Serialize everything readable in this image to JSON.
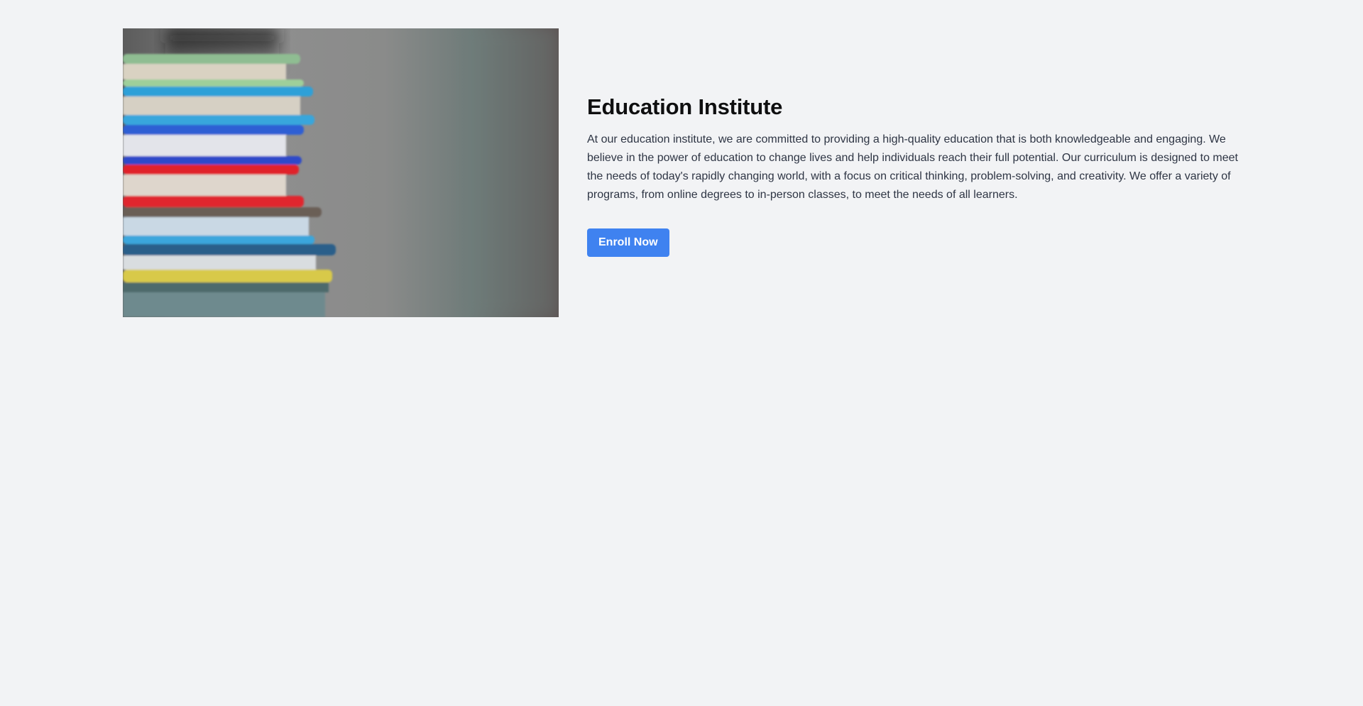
{
  "hero": {
    "title": "Education Institute",
    "description": "At our education institute, we are committed to providing a high-quality education that is both knowledgeable and engaging. We believe in the power of education to change lives and help individuals reach their full potential. Our curriculum is designed to meet the needs of today's rapidly changing world, with a focus on critical thinking, problem-solving, and creativity. We offer a variety of programs, from online degrees to in-person classes, to meet the needs of all learners.",
    "cta_label": "Enroll Now",
    "image_subject": "stack of colorful books"
  },
  "colors": {
    "background": "#f2f3f5",
    "accent": "#3f82f0",
    "title": "#0f0f10",
    "body_text": "#2e3544"
  }
}
